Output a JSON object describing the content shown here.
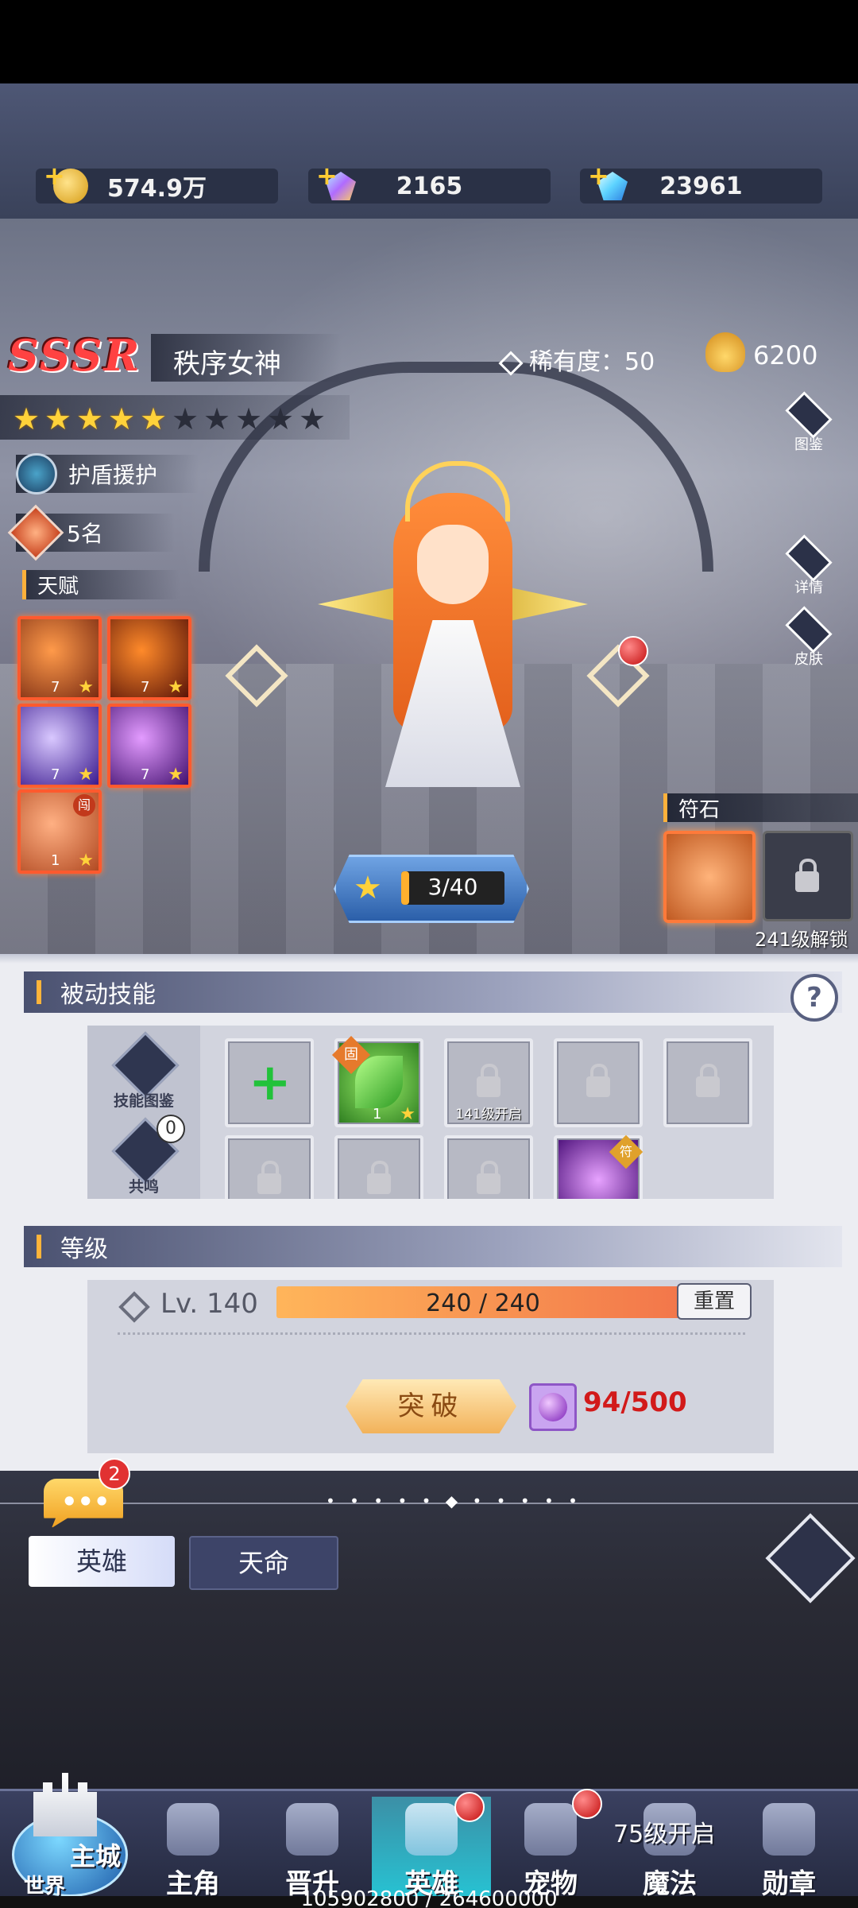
{
  "currencies": [
    {
      "icon": "gold-coin-icon",
      "value": "574.9万"
    },
    {
      "icon": "rainbow-gem-icon",
      "value": "2165"
    },
    {
      "icon": "blue-diamond-icon",
      "value": "23961"
    }
  ],
  "hero": {
    "grade": "SSSR",
    "name": "秩序女神",
    "rarity_label": "稀有度：50",
    "power": "6200",
    "stars_total": 10,
    "stars_filled": 5,
    "role": "护盾援护",
    "rank": "5名"
  },
  "talents": {
    "label": "天赋",
    "items": [
      {
        "level": "7",
        "colors": [
          "#ff9a4a",
          "#7a2b12"
        ]
      },
      {
        "level": "7",
        "colors": [
          "#ff8a2a",
          "#5a1408"
        ]
      },
      {
        "level": "7",
        "colors": [
          "#d9c8ff",
          "#3a1a8e"
        ]
      },
      {
        "level": "7",
        "colors": [
          "#e39bff",
          "#41106e"
        ]
      },
      {
        "level": "1",
        "colors": [
          "#ffb083",
          "#b24a22"
        ],
        "badge": "闯"
      }
    ]
  },
  "side_buttons": [
    "图鉴",
    "详情",
    "皮肤"
  ],
  "level_progress": "3/40",
  "rune": {
    "label": "符石",
    "unlock": "241级解锁"
  },
  "passive": {
    "title": "被动技能",
    "help": "?",
    "side": {
      "codex": "技能图鉴",
      "resonance": "共鸣",
      "resonance_count": "0"
    },
    "slots": [
      {
        "type": "add"
      },
      {
        "type": "skill",
        "level": "1",
        "tag": "固"
      },
      {
        "type": "locked",
        "label": "141级开启"
      },
      {
        "type": "locked"
      },
      {
        "type": "locked"
      },
      {
        "type": "locked"
      },
      {
        "type": "locked"
      },
      {
        "type": "locked"
      },
      {
        "type": "skill-purple",
        "tag": "符"
      }
    ]
  },
  "level": {
    "title": "等级",
    "lv": "Lv. 140",
    "xp": "240 / 240",
    "xp_fraction": 1,
    "reset": "重置",
    "breakthrough": "突破",
    "cost": "94/500"
  },
  "chat_badge": "2",
  "tabs": {
    "hero": "英雄",
    "fate": "天命"
  },
  "nav": {
    "city_main": "主城",
    "city_sub": "世界",
    "items": [
      "主角",
      "晋升",
      "英雄",
      "宠物",
      "魔法",
      "勋章"
    ],
    "locked_text": "75级开启"
  },
  "bottom_text": "105902800 / 264600000"
}
